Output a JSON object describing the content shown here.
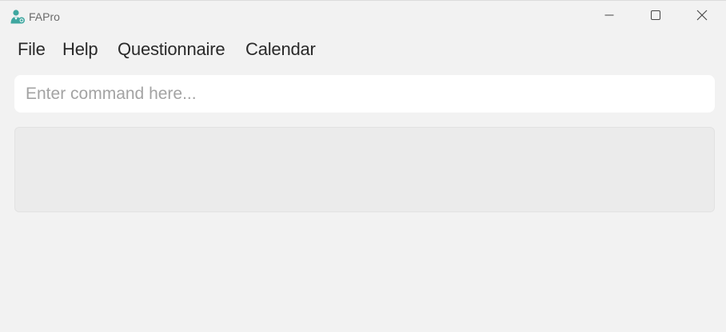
{
  "window": {
    "title": "FAPro",
    "icon": "doctor-user-icon",
    "controls": {
      "minimize_icon": "minimize-icon",
      "maximize_icon": "maximize-icon",
      "close_icon": "close-icon"
    }
  },
  "menu": {
    "items": [
      {
        "label": "File"
      },
      {
        "label": "Help"
      },
      {
        "label": "Questionnaire"
      },
      {
        "label": "Calendar"
      }
    ]
  },
  "command": {
    "placeholder": "Enter command here...",
    "value": ""
  },
  "result": {
    "text": ""
  },
  "colors": {
    "background": "#f2f2f2",
    "input": "#ffffff",
    "panel": "#ebebeb",
    "icon_accent": "#3fa7a0"
  }
}
